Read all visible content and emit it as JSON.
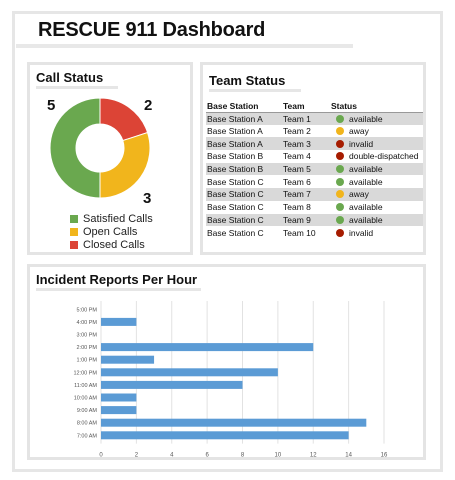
{
  "header": {
    "title": "RESCUE 911 Dashboard"
  },
  "call_status": {
    "title": "Call Status",
    "segments": [
      {
        "name": "Satisfied Calls",
        "value": 5,
        "color": "#6aa84f"
      },
      {
        "name": "Open Calls",
        "value": 3,
        "color": "#f1b51c"
      },
      {
        "name": "Closed Calls",
        "value": 2,
        "color": "#dc4436"
      }
    ]
  },
  "team_status": {
    "title": "Team Status",
    "columns": [
      "Base Station",
      "Team",
      "Status"
    ],
    "status_colors": {
      "available": "#6aa84f",
      "away": "#f1b51c",
      "invalid": "#a61c00",
      "double-dispatched": "#a61c00"
    },
    "rows": [
      {
        "station": "Base Station A",
        "team": "Team 1",
        "status": "available"
      },
      {
        "station": "Base Station A",
        "team": "Team 2",
        "status": "away"
      },
      {
        "station": "Base Station A",
        "team": "Team 3",
        "status": "invalid"
      },
      {
        "station": "Base Station B",
        "team": "Team 4",
        "status": "double-dispatched"
      },
      {
        "station": "Base Station B",
        "team": "Team 5",
        "status": "available"
      },
      {
        "station": "Base Station C",
        "team": "Team 6",
        "status": "available"
      },
      {
        "station": "Base Station C",
        "team": "Team 7",
        "status": "away"
      },
      {
        "station": "Base Station C",
        "team": "Team 8",
        "status": "available"
      },
      {
        "station": "Base Station C",
        "team": "Team 9",
        "status": "available"
      },
      {
        "station": "Base Station C",
        "team": "Team 10",
        "status": "invalid"
      }
    ]
  },
  "incidents": {
    "title": "Incident Reports Per Hour"
  },
  "chart_data": [
    {
      "type": "pie",
      "categories": [
        "Satisfied Calls",
        "Open Calls",
        "Closed Calls"
      ],
      "values": [
        5,
        3,
        2
      ],
      "title": "Call Status",
      "legend": "bottom"
    },
    {
      "type": "bar",
      "orientation": "horizontal",
      "title": "Incident Reports Per Hour",
      "categories": [
        "5:00 PM",
        "4:00 PM",
        "3:00 PM",
        "2:00 PM",
        "1:00 PM",
        "12:00 PM",
        "11:00 AM",
        "10:00 AM",
        "9:00 AM",
        "8:00 AM",
        "7:00 AM"
      ],
      "values": [
        0,
        2,
        0,
        12,
        3,
        10,
        8,
        2,
        2,
        15,
        14
      ],
      "xlim": [
        0,
        16
      ],
      "xticks": [
        0,
        2,
        4,
        6,
        8,
        10,
        12,
        14,
        16
      ],
      "color": "#5b9bd5",
      "grid": true
    }
  ]
}
